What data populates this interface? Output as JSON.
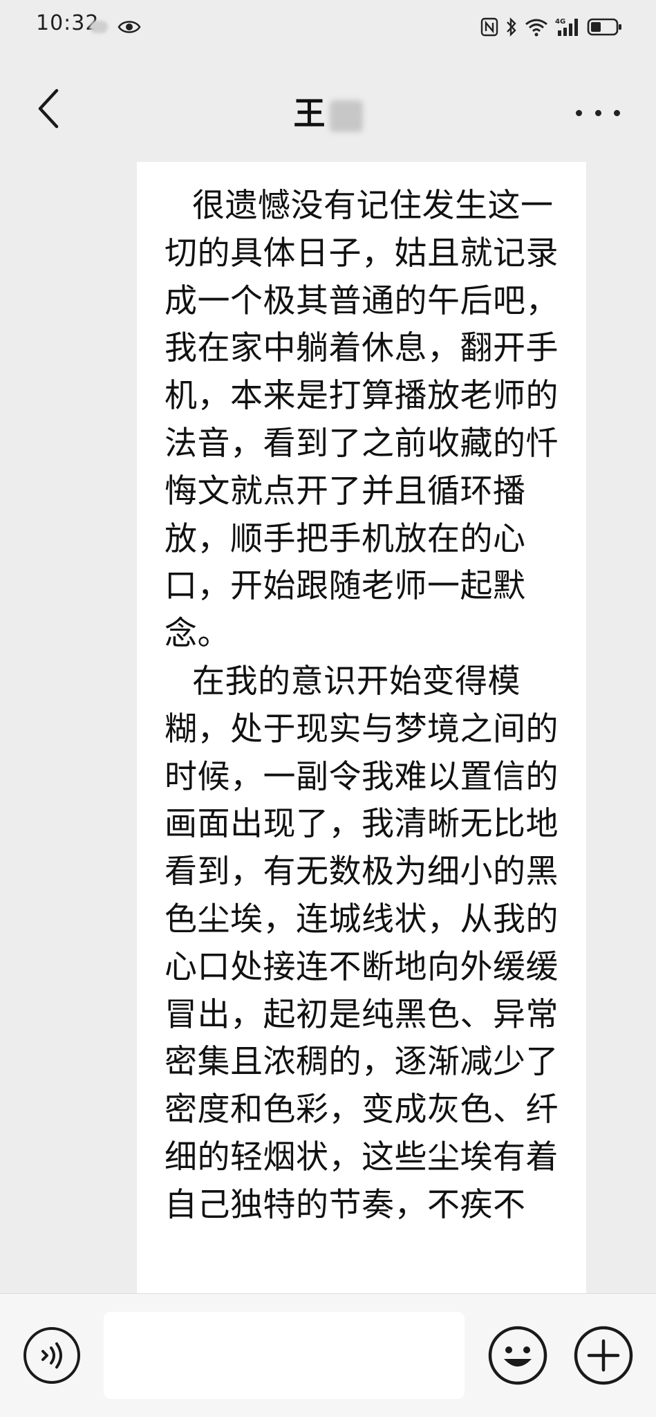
{
  "status_bar": {
    "time": "10:32",
    "network": "4G"
  },
  "header": {
    "title": "王"
  },
  "message": {
    "paragraphs": [
      "很遗憾没有记住发生这一切的具体日子，姑且就记录成一个极其普通的午后吧，我在家中躺着休息，翻开手机，本来是打算播放老师的法音，看到了之前收藏的忏悔文就点开了并且循环播放，顺手把手机放在的心口，开始跟随老师一起默念。",
      "在我的意识开始变得模糊，处于现实与梦境之间的时候，一副令我难以置信的画面出现了，我清晰无比地看到，有无数极为细小的黑色尘埃，连城线状，从我的心口处接连不断地向外缓缓冒出，起初是纯黑色、异常密集且浓稠的，逐渐减少了密度和色彩，变成灰色、纤细的轻烟状，这些尘埃有着自己独特的节奏，不疾不"
    ]
  },
  "input": {
    "value": ""
  },
  "icons": {
    "back": "chevron-left-icon",
    "more": "more-dots-icon",
    "voice": "voice-icon",
    "emoji": "emoji-icon",
    "add": "plus-icon",
    "eye": "eye-icon",
    "battery": "battery-icon",
    "wifi": "wifi-icon",
    "bluetooth": "bluetooth-icon",
    "nfc": "nfc-icon",
    "signal": "signal-icon"
  },
  "colors": {
    "background": "#ededed",
    "bubble": "#ffffff",
    "text": "#111111",
    "input_bar": "#f6f6f6"
  }
}
